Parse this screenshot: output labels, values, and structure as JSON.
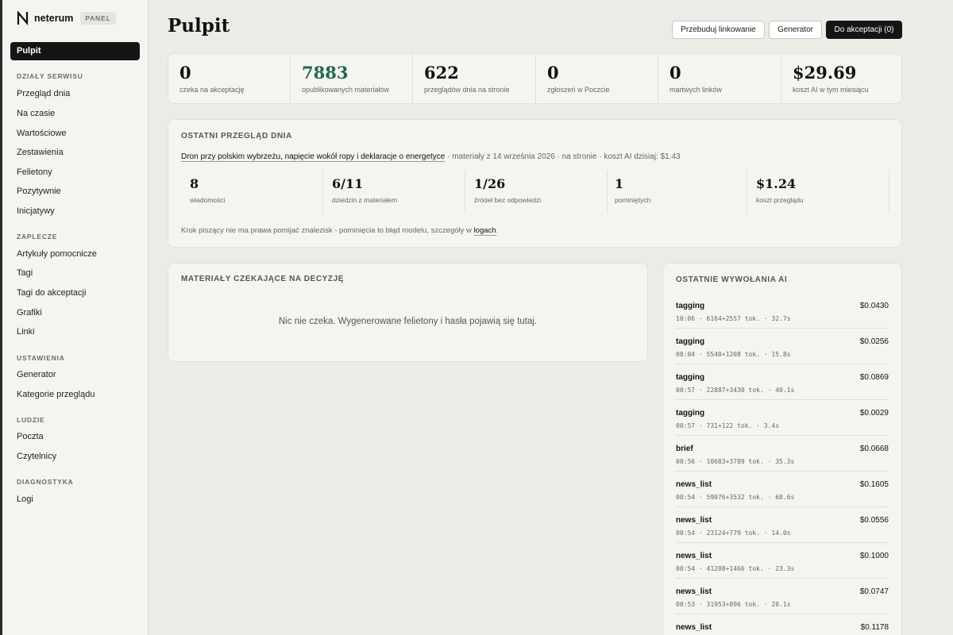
{
  "brand": {
    "name": "neterum",
    "badge": "PANEL"
  },
  "sidebar": {
    "active": "Pulpit",
    "sections": [
      {
        "title": "DZIAŁY SERWISU",
        "items": [
          "Przegląd dnia",
          "Na czasie",
          "Wartościowe",
          "Zestawienia",
          "Felietony",
          "Pozytywnie",
          "Inicjatywy"
        ]
      },
      {
        "title": "ZAPLECZE",
        "items": [
          "Artykuły pomocnicze",
          "Tagi",
          "Tagi do akceptacji",
          "Grafiki",
          "Linki"
        ]
      },
      {
        "title": "USTAWIENIA",
        "items": [
          "Generator",
          "Kategorie przeglądu"
        ]
      },
      {
        "title": "LUDZIE",
        "items": [
          "Poczta",
          "Czytelnicy"
        ]
      },
      {
        "title": "DIAGNOSTYKA",
        "items": [
          "Logi"
        ]
      }
    ]
  },
  "header": {
    "title": "Pulpit",
    "buttons": [
      "Przebuduj linkowanie",
      "Generator",
      "Do akceptacji (0)"
    ]
  },
  "stats": [
    {
      "value": "0",
      "label": "czeka na akceptację"
    },
    {
      "value": "7883",
      "label": "opublikowanych materiałów",
      "color": "#1f6b47"
    },
    {
      "value": "622",
      "label": "przeglądów dnia na stronie"
    },
    {
      "value": "0",
      "label": "zgłoszeń w Poczcie"
    },
    {
      "value": "0",
      "label": "martwych linków"
    },
    {
      "value": "$29.69",
      "label": "koszt AI w tym miesiącu"
    }
  ],
  "review": {
    "heading": "OSTATNI PRZEGLĄD DNIA",
    "headline": "Dron przy polskim wybrzeżu, napięcie wokół ropy i deklaracje o energetyce",
    "meta": " · materiały z 14 września 2026 · na stronie · koszt AI dzisiaj: $1.43",
    "stats": [
      {
        "value": "8",
        "label": "wiadomości"
      },
      {
        "value": "6/11",
        "label": "dziedzin z materiałem"
      },
      {
        "value": "1/26",
        "label": "źródeł bez odpowiedzi"
      },
      {
        "value": "1",
        "label": "pominiętych"
      },
      {
        "value": "$1.24",
        "label": "koszt przeglądu"
      }
    ],
    "note": "Krok piszący nie ma prawa pomijać znalezisk - pominięcia to błąd modelu, szczegóły w ",
    "note_link": "logach",
    "note_end": "."
  },
  "pending": {
    "heading": "MATERIAŁY CZEKAJĄCE NA DECYZJĘ",
    "empty": "Nic nie czeka. Wygenerowane felietony i hasła pojawią się tutaj."
  },
  "ai_calls": {
    "heading": "OSTATNIE WYWOŁANIA AI",
    "rows": [
      {
        "name": "tagging",
        "cost": "$0.0430",
        "meta": "10:06 · 6164+2557 tok. · 32.7s"
      },
      {
        "name": "tagging",
        "cost": "$0.0256",
        "meta": "08:04 · 5540+1208 tok. · 15.8s"
      },
      {
        "name": "tagging",
        "cost": "$0.0869",
        "meta": "00:57 · 22887+3430 tok. · 40.1s"
      },
      {
        "name": "tagging",
        "cost": "$0.0029",
        "meta": "00:57 · 731+122 tok. · 3.4s"
      },
      {
        "name": "brief",
        "cost": "$0.0668",
        "meta": "00:56 · 10683+3789 tok. · 35.3s"
      },
      {
        "name": "news_list",
        "cost": "$0.1605",
        "meta": "00:54 · 59076+3532 tok. · 68.6s"
      },
      {
        "name": "news_list",
        "cost": "$0.0556",
        "meta": "00:54 · 23124+779 tok. · 14.0s"
      },
      {
        "name": "news_list",
        "cost": "$0.1000",
        "meta": "00:54 · 41208+1466 tok. · 23.3s"
      },
      {
        "name": "news_list",
        "cost": "$0.0747",
        "meta": "00:53 · 31953+896 tok. · 20.1s"
      },
      {
        "name": "news_list",
        "cost": "$0.1178",
        "meta": ""
      }
    ]
  }
}
